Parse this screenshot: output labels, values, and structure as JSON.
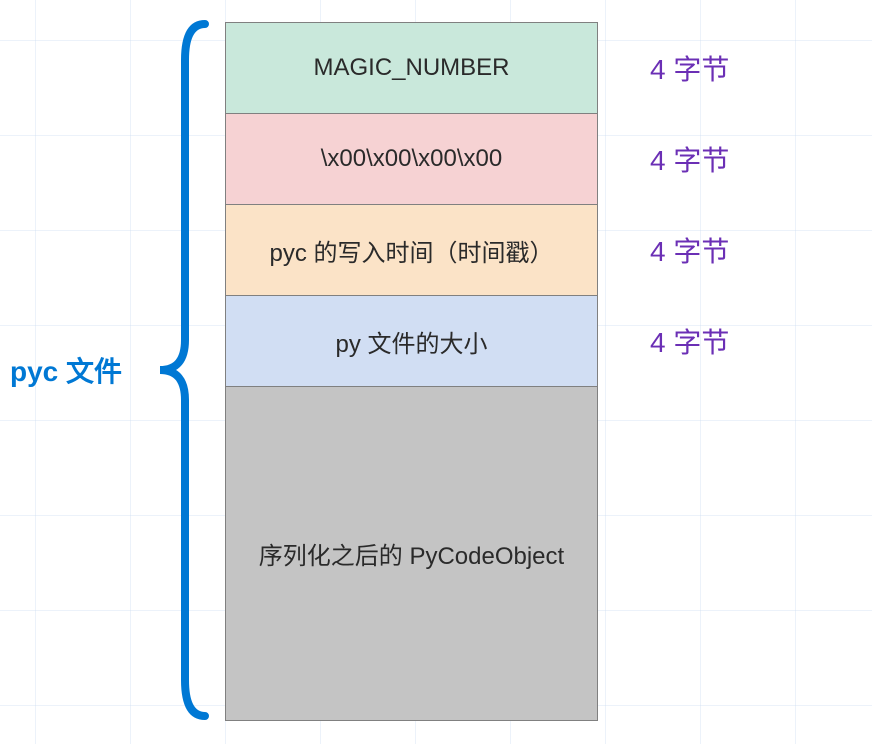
{
  "title": "pyc 文件",
  "blocks": [
    {
      "label": "MAGIC_NUMBER",
      "size": "4 字节",
      "color": "#C9E8DB"
    },
    {
      "label": "\\x00\\x00\\x00\\x00",
      "size": "4 字节",
      "color": "#F6D2D3"
    },
    {
      "label": "pyc 的写入时间（时间戳）",
      "size": "4 字节",
      "color": "#FBE3C7"
    },
    {
      "label": "py 文件的大小",
      "size": "4 字节",
      "color": "#D1DEF3"
    },
    {
      "label": "序列化之后的 PyCodeObject",
      "size": "",
      "color": "#C4C4C4"
    }
  ]
}
